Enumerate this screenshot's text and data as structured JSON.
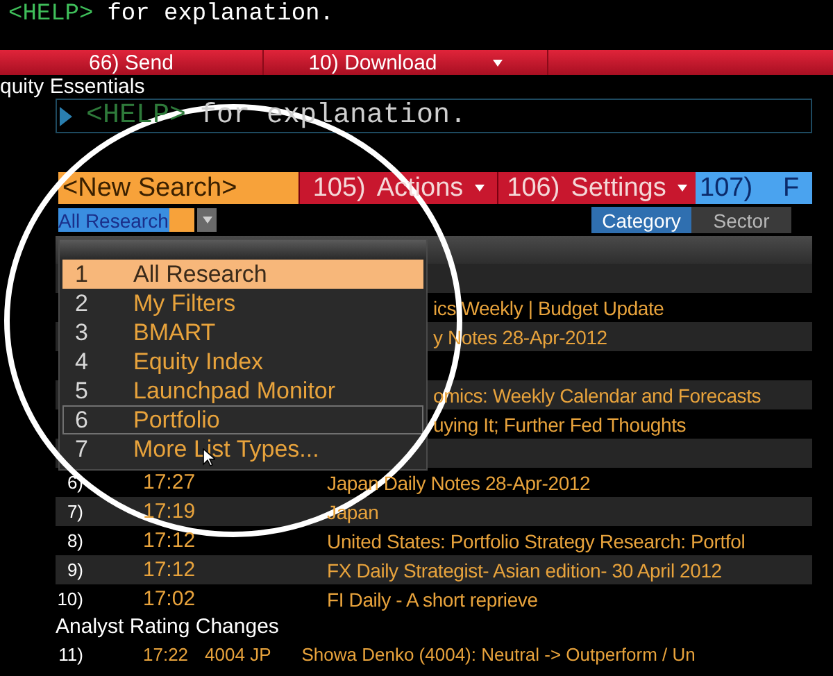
{
  "command_line": {
    "prompt": "<HELP>",
    "text": "for explanation."
  },
  "action_bar": [
    {
      "label": "66) Send",
      "dropdown": false
    },
    {
      "label": "10) Download",
      "dropdown": true
    }
  ],
  "section_title": "quity Essentials",
  "input": {
    "prompt": "<HELP>",
    "text": "for explanation."
  },
  "toolbar": [
    {
      "kind": "search",
      "label": "<New Search>"
    },
    {
      "kind": "menu",
      "number": "105)",
      "label": "Actions"
    },
    {
      "kind": "menu",
      "number": "106)",
      "label": "Settings"
    },
    {
      "kind": "link",
      "number": "107)",
      "label": "F"
    }
  ],
  "list_select": {
    "value": "All Research"
  },
  "tabs": [
    {
      "label": "Category",
      "selected": true
    },
    {
      "label": "Sector",
      "selected": false
    }
  ],
  "dropdown_menu": [
    {
      "number": "1",
      "label": "All Research",
      "selected": true,
      "hovered": false
    },
    {
      "number": "2",
      "label": "My Filters",
      "selected": false,
      "hovered": false
    },
    {
      "number": "3",
      "label": "BMART",
      "selected": false,
      "hovered": false
    },
    {
      "number": "4",
      "label": "Equity Index",
      "selected": false,
      "hovered": false
    },
    {
      "number": "5",
      "label": "Launchpad Monitor",
      "selected": false,
      "hovered": false
    },
    {
      "number": "6",
      "label": "Portfolio",
      "selected": false,
      "hovered": true
    },
    {
      "number": "7",
      "label": "More List Types...",
      "selected": false,
      "hovered": false
    }
  ],
  "rows": [
    {
      "shaded": true
    },
    {
      "headline": "ics Weekly | Budget Update",
      "shaded": false
    },
    {
      "headline": "y Notes 28-Apr-2012",
      "shaded": true
    },
    {
      "shaded": false
    },
    {
      "headline": "omics: Weekly Calendar and Forecasts",
      "shaded": true
    },
    {
      "headline": "uying It; Further Fed Thoughts",
      "shaded": false
    },
    {
      "shaded": true
    },
    {
      "number": "6)",
      "time": "17:27",
      "headline": "Japan Daily Notes 28-Apr-2012",
      "shaded": false
    },
    {
      "number": "7)",
      "time": "17:19",
      "headline": "Japan",
      "shaded": true
    },
    {
      "number": "8)",
      "time": "17:12",
      "headline": "United States: Portfolio Strategy Research: Portfol",
      "shaded": false
    },
    {
      "number": "9)",
      "time": "17:12",
      "headline": "FX Daily Strategist- Asian edition- 30 April 2012",
      "shaded": true
    },
    {
      "number": "10)",
      "time": "17:02",
      "headline": "FI Daily - A short reprieve",
      "shaded": false
    }
  ],
  "group_heading": "Analyst Rating Changes",
  "last_row": {
    "number": "11)",
    "time": "17:22",
    "ticker": "4004 JP",
    "headline": "Showa Denko (4004): Neutral -> Outperform / Un"
  }
}
